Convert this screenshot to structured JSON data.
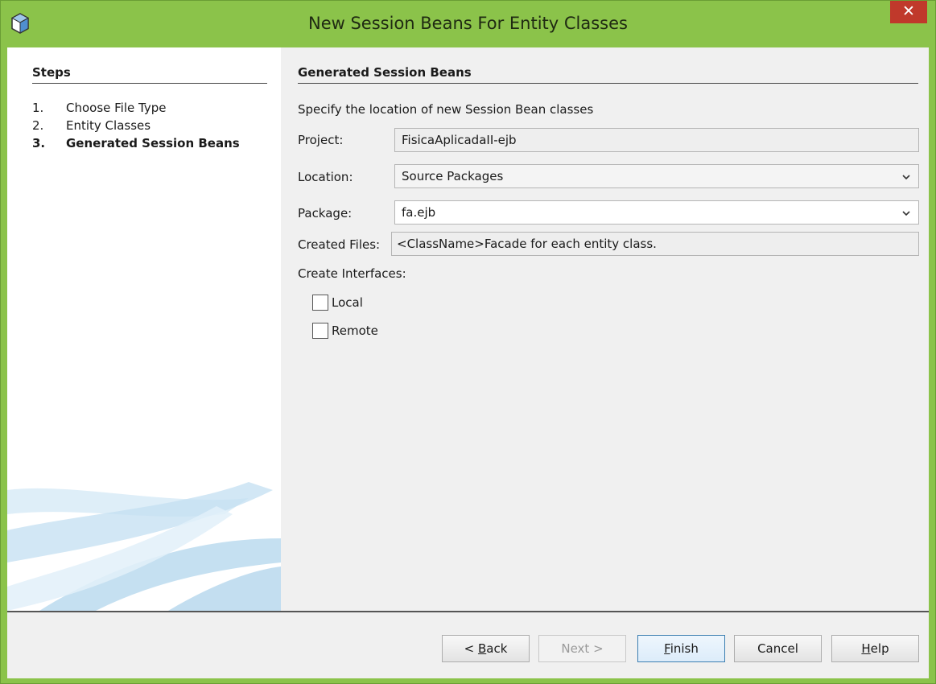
{
  "window": {
    "title": "New Session Beans For Entity Classes",
    "close_glyph": "✕",
    "accent_color": "#8bc34a",
    "close_color": "#c0392b"
  },
  "steps": {
    "title": "Steps",
    "items": [
      {
        "num": "1.",
        "label": "Choose File Type",
        "current": false
      },
      {
        "num": "2.",
        "label": "Entity Classes",
        "current": false
      },
      {
        "num": "3.",
        "label": "Generated Session Beans",
        "current": true
      }
    ]
  },
  "main": {
    "title": "Generated Session Beans",
    "description": "Specify the location of new Session Bean classes",
    "project": {
      "label": "Project:",
      "value": "FisicaAplicadaII-ejb"
    },
    "location": {
      "label": "Location:",
      "value": "Source Packages"
    },
    "package": {
      "label": "Package:",
      "value": "fa.ejb"
    },
    "created_files": {
      "label": "Created Files:",
      "value": "<ClassName>Facade for each entity class."
    },
    "create_interfaces": {
      "label": "Create Interfaces:",
      "options": [
        {
          "label": "Local",
          "checked": false
        },
        {
          "label": "Remote",
          "checked": false
        }
      ]
    }
  },
  "buttons": {
    "back": {
      "prefix": "< ",
      "mnemonic": "B",
      "rest": "ack"
    },
    "next": "Next >",
    "finish": {
      "mnemonic": "F",
      "rest": "inish"
    },
    "cancel": "Cancel",
    "help": {
      "mnemonic": "H",
      "rest": "elp"
    }
  }
}
